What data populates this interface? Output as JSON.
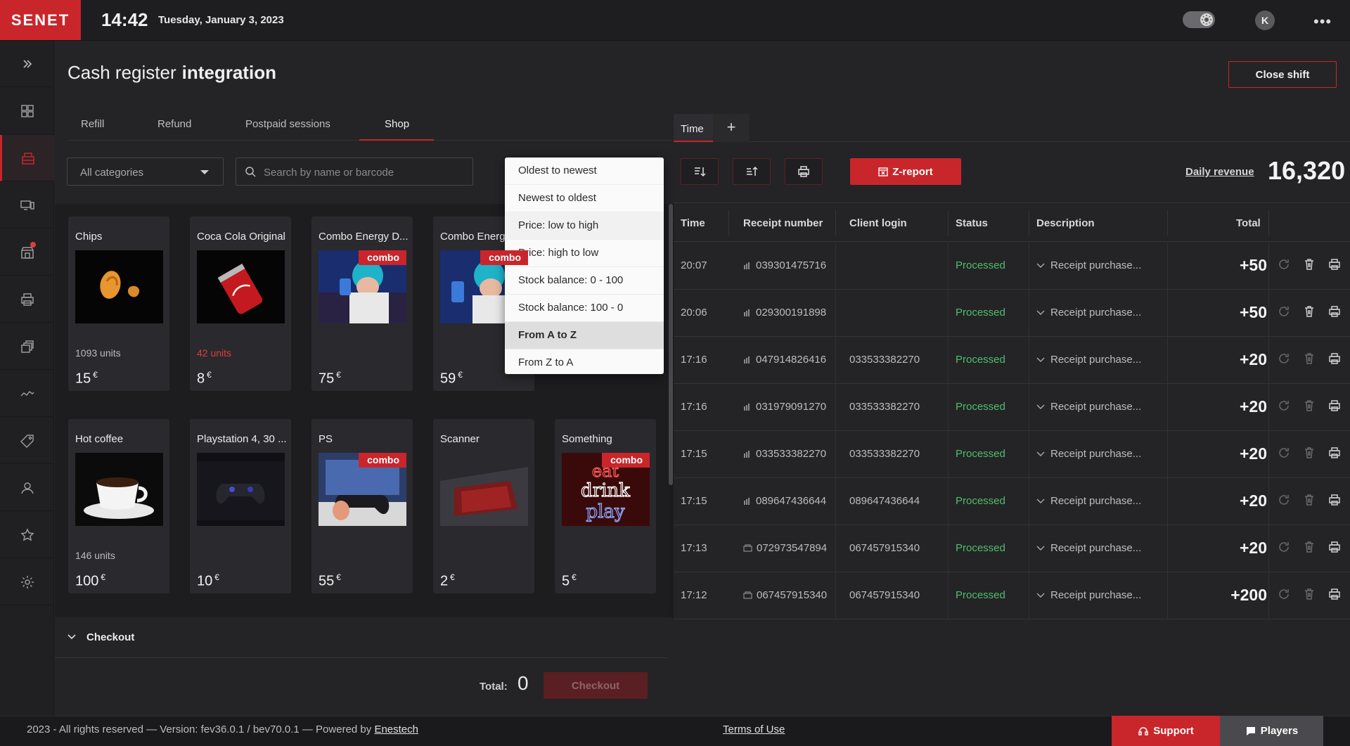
{
  "brand": {
    "logo": "SENET",
    "accent": "#c8262b"
  },
  "header": {
    "time": "14:42",
    "date": "Tuesday, January 3, 2023",
    "theme_icon": "sun-icon",
    "avatar_initial": "K",
    "more_label": "•••"
  },
  "sidebar": {
    "items": [
      "expand-icon",
      "dashboard-icon",
      "cash-register-icon",
      "devices-icon",
      "shop-icon",
      "printer-icon",
      "layers-icon",
      "analytics-icon",
      "promo-icon",
      "users-icon",
      "star-icon",
      "settings-icon"
    ]
  },
  "page": {
    "title_light": "Cash register",
    "title_bold": "integration",
    "close_shift": "Close shift"
  },
  "tabs": {
    "refill": "Refill",
    "refund": "Refund",
    "postpaid": "Postpaid sessions",
    "shop": "Shop"
  },
  "filters": {
    "category": "All categories",
    "search_placeholder": "Search by name or barcode"
  },
  "products": [
    {
      "name": "Chips",
      "units": "1093 units",
      "price": "15",
      "currency": "€",
      "combo": ""
    },
    {
      "name": "Coca Cola Original",
      "units": "42 units",
      "price": "8",
      "currency": "€",
      "combo": ""
    },
    {
      "name": "Combo Energy D...",
      "units": "",
      "price": "75",
      "currency": "€",
      "combo": "combo"
    },
    {
      "name": "Combo Energy",
      "units": "",
      "price": "59",
      "currency": "€",
      "combo": "combo"
    },
    {
      "name": "Hot coffee",
      "units": "146 units",
      "price": "100",
      "currency": "€",
      "combo": ""
    },
    {
      "name": "Playstation 4, 30 ...",
      "units": "",
      "price": "10",
      "currency": "€",
      "combo": ""
    },
    {
      "name": "PS",
      "units": "",
      "price": "55",
      "currency": "€",
      "combo": "combo"
    },
    {
      "name": "Scanner",
      "units": "",
      "price": "2",
      "currency": "€",
      "combo": ""
    },
    {
      "name": "Something",
      "units": "",
      "price": "5",
      "currency": "€",
      "combo": "combo",
      "neon": [
        "eat",
        "drink",
        "play"
      ]
    }
  ],
  "sort_menu": {
    "items": [
      "Oldest to newest",
      "Newest to oldest",
      "Price: low to high",
      "Price: high to low",
      "Stock balance: 0 - 100",
      "Stock balance: 100 - 0",
      "From A to Z",
      "From Z to A"
    ],
    "selected": "From A to Z"
  },
  "checkout": {
    "label": "Checkout",
    "total_label": "Total:",
    "total_value": "0",
    "button": "Checkout"
  },
  "receipts": {
    "tab": "Time",
    "add": "+",
    "z_report": "Z-report",
    "daily_revenue_label": "Daily revenue",
    "daily_revenue_value": "16,320",
    "columns": {
      "time": "Time",
      "receipt": "Receipt number",
      "login": "Client login",
      "status": "Status",
      "description": "Description",
      "total": "Total"
    },
    "rows": [
      {
        "time": "20:07",
        "receipt": "039301475716",
        "login": "",
        "status": "Processed",
        "description": "Receipt purchase...",
        "total": "+50",
        "type": "card"
      },
      {
        "time": "20:06",
        "receipt": "029300191898",
        "login": "",
        "status": "Processed",
        "description": "Receipt purchase...",
        "total": "+50",
        "type": "card"
      },
      {
        "time": "17:16",
        "receipt": "047914826416",
        "login": "033533382270",
        "status": "Processed",
        "description": "Receipt purchase...",
        "total": "+20",
        "type": "card"
      },
      {
        "time": "17:16",
        "receipt": "031979091270",
        "login": "033533382270",
        "status": "Processed",
        "description": "Receipt purchase...",
        "total": "+20",
        "type": "card"
      },
      {
        "time": "17:15",
        "receipt": "033533382270",
        "login": "033533382270",
        "status": "Processed",
        "description": "Receipt purchase...",
        "total": "+20",
        "type": "card"
      },
      {
        "time": "17:15",
        "receipt": "089647436644",
        "login": "089647436644",
        "status": "Processed",
        "description": "Receipt purchase...",
        "total": "+20",
        "type": "card"
      },
      {
        "time": "17:13",
        "receipt": "072973547894",
        "login": "067457915340",
        "status": "Processed",
        "description": "Receipt purchase...",
        "total": "+20",
        "type": "cash"
      },
      {
        "time": "17:12",
        "receipt": "067457915340",
        "login": "067457915340",
        "status": "Processed",
        "description": "Receipt purchase...",
        "total": "+200",
        "type": "cash"
      }
    ]
  },
  "footer": {
    "copyright": "2023 - All rights reserved — Version: fev36.0.1 / bev70.0.1 — Powered by",
    "powered_by": "Enestech",
    "terms": "Terms of Use",
    "support": "Support",
    "players": "Players"
  }
}
